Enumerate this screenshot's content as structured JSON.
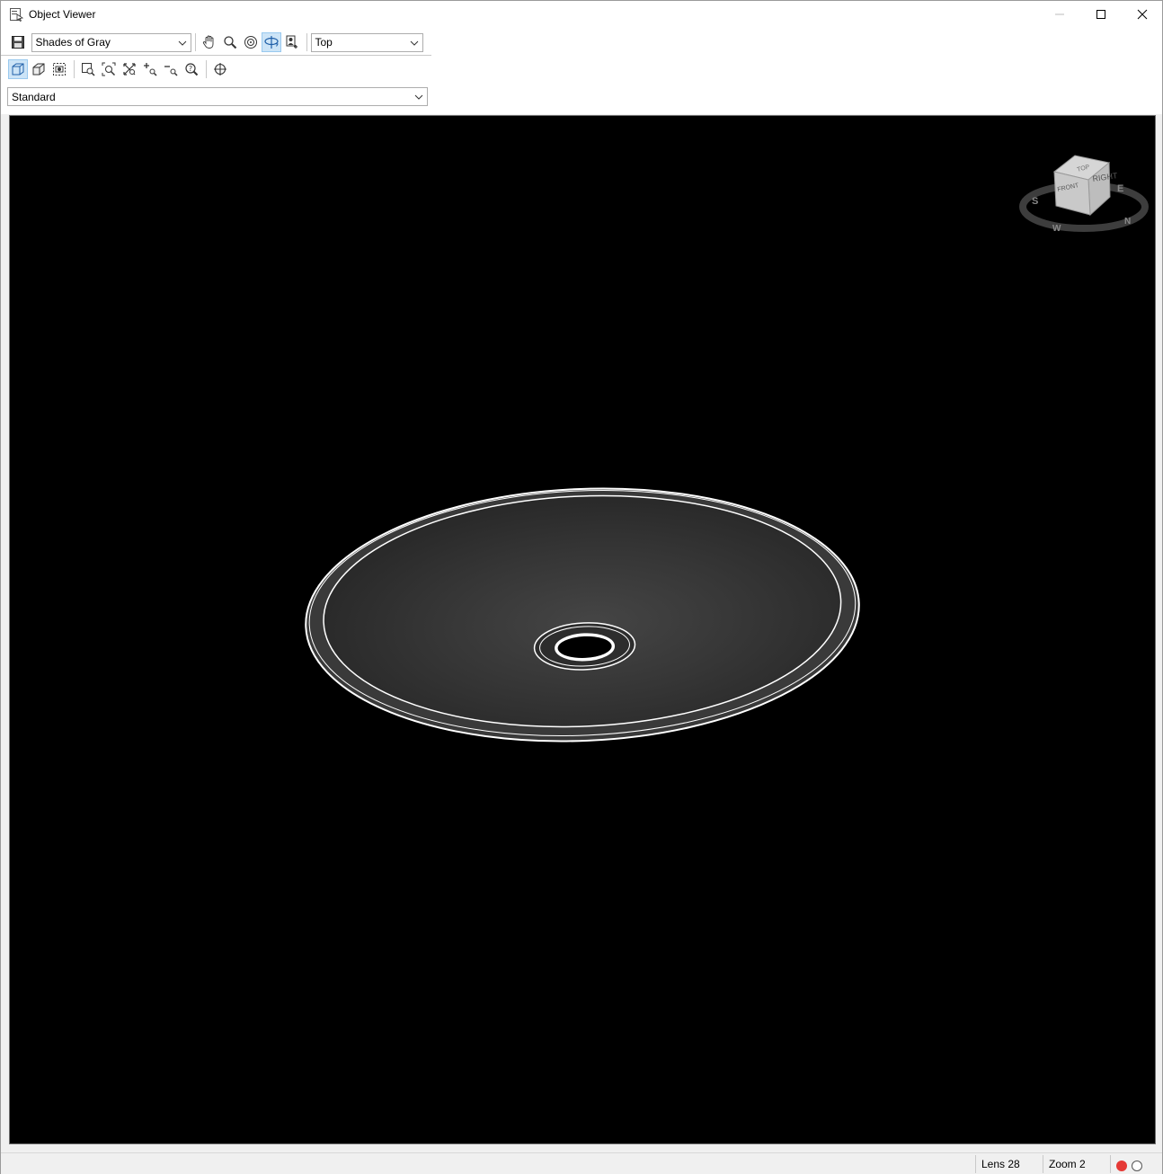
{
  "window": {
    "title": "Object Viewer"
  },
  "toolbar": {
    "visual_style": "Shades of Gray",
    "view": "Top",
    "ucs": "Standard"
  },
  "viewcube": {
    "faces": [
      "TOP",
      "RIGHT",
      "FRONT"
    ],
    "compass": [
      "S",
      "N",
      "E",
      "W"
    ]
  },
  "status": {
    "lens": "Lens 28",
    "zoom": "Zoom 2"
  },
  "colors": {
    "viewport_bg": "#000000",
    "active_tool": "#cce4f7",
    "status_red": "#e53935"
  }
}
